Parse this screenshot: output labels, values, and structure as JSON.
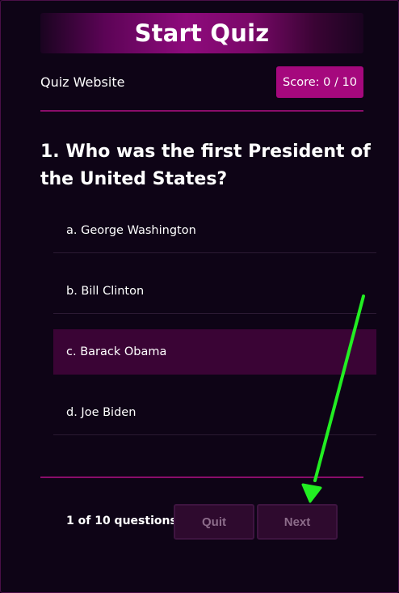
{
  "header": {
    "title": "Start Quiz"
  },
  "site": {
    "title": "Quiz Website"
  },
  "score": {
    "label": "Score: 0 / 10"
  },
  "question": {
    "text": "1. Who was the first President of the United States?"
  },
  "options": [
    {
      "label": "a. George Washington",
      "selected": false
    },
    {
      "label": "b. Bill Clinton",
      "selected": false
    },
    {
      "label": "c. Barack Obama",
      "selected": true
    },
    {
      "label": "d. Joe Biden",
      "selected": false
    }
  ],
  "footer": {
    "progress": "1 of 10 questions",
    "quit_label": "Quit",
    "next_label": "Next"
  },
  "colors": {
    "accent": "#a5087d",
    "selected_bg": "#3a0435",
    "annotation_arrow": "#22ee22"
  }
}
